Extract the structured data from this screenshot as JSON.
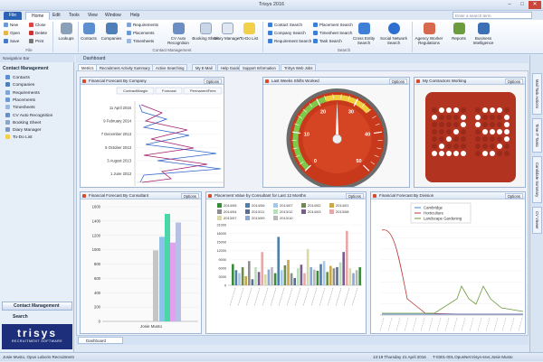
{
  "window": {
    "title": "Trisys 2016"
  },
  "menu": {
    "tabs": [
      "File",
      "Home",
      "Edit",
      "Tools",
      "View",
      "Window",
      "Help"
    ],
    "search_placeholder": "Enter a search term"
  },
  "ribbon": {
    "file_group": {
      "items": [
        "New",
        "Open",
        "Save",
        "Close",
        "Delete",
        "Print"
      ],
      "label": "File"
    },
    "lookups": "Lookups",
    "contacts": "Contacts",
    "companies": "Companies",
    "cm_small": [
      "Requirements",
      "Placements",
      "Timesheets"
    ],
    "cv_auto": "CV Auto Recognition",
    "booking": "Booking Sheet",
    "diary": "Diary Manager",
    "todo": "To-Do List",
    "cm_label": "Contact Management",
    "search_small_a": [
      "Contact Search",
      "Company Search",
      "Requirement Search"
    ],
    "search_small_b": [
      "Placement Search",
      "Timesheet Search",
      "Task Search"
    ],
    "cross_entity": "Cross Entity Search",
    "social": "Social Network Search",
    "search_label": "Search",
    "agency": "Agency Worker Regulations",
    "reports": "Reports",
    "bi": "Business Intelligence"
  },
  "nav": {
    "header": "Navigation Bar",
    "section": "Contact Management",
    "items": [
      "Contacts",
      "Companies",
      "Requirements",
      "Placements",
      "Timesheets",
      "CV Auto Recognition",
      "Booking Sheet",
      "Diary Manager",
      "To-Do List"
    ],
    "btn_cm": "Contact Management",
    "btn_search": "Search",
    "logo_word": "trisys",
    "logo_sub": "RECRUITMENT SOFTWARE"
  },
  "dashboard": {
    "title": "Dashboard",
    "tabs": [
      "Metrics",
      "Recruitment Activity Summary",
      "Active Searching",
      "My E-Mail",
      "Help Guide",
      "Support Information",
      "TriSys Web Jobs"
    ],
    "options_label": "Options"
  },
  "panels": {
    "p1": {
      "title": "Financial Forecast By Company",
      "legend": [
        "ContractMargin",
        "Forecast",
        "PermanentFees"
      ],
      "dates": [
        "11 April 2016",
        "9 February 2014",
        "7 December 2013",
        "5 October 2013",
        "3 August 2013",
        "1 June 2013"
      ]
    },
    "p2": {
      "title": "Last Weeks Shifts Worked",
      "ticks": [
        "0",
        "10",
        "20",
        "30",
        "40",
        "50"
      ]
    },
    "p3": {
      "title": "My Contractors Working",
      "value": "29"
    },
    "p4": {
      "title": "Financial Forecast By Consultant",
      "y_ticks": [
        "1600",
        "1400",
        "1200",
        "1000",
        "800",
        "600",
        "400",
        "200",
        "0"
      ],
      "x_label": "Josie Musto"
    },
    "p5": {
      "title": "Placement Value by Consultant for Last 12 Months",
      "legend": [
        "2014/05",
        "2014/06",
        "2014/07",
        "2014/02",
        "2014/01",
        "2014/04",
        "2013/11",
        "2013/12",
        "2014/03",
        "2013/08",
        "2013/07",
        "2013/09",
        "2013/10"
      ],
      "y_ticks": [
        "21000",
        "18000",
        "15000",
        "12000",
        "9000",
        "6000",
        "3000",
        "0"
      ]
    },
    "p6": {
      "title": "Financial Forecast By Division",
      "legend": [
        "Cambridge",
        "Horticulture",
        "Landscape Gardening"
      ]
    }
  },
  "right_tabs": [
    "Mail Task Actions",
    "Time IT Tasks",
    "Candidate Summary",
    "CV Viewer"
  ],
  "bottom": {
    "tab": "Dashboard"
  },
  "status": {
    "left": "Josie Musto, Opus Laboris Recruitment",
    "time": "13:19  Thursday 21 April 2016",
    "right": "T-0301-001.OpusNet trisys-ssvr,Josie Musto"
  },
  "colors": {
    "file_tab": "#2a63b5",
    "logo_bg": "#1d2f7a",
    "gauge_face": "#c8391b",
    "contractor_bg": "#b23320"
  }
}
